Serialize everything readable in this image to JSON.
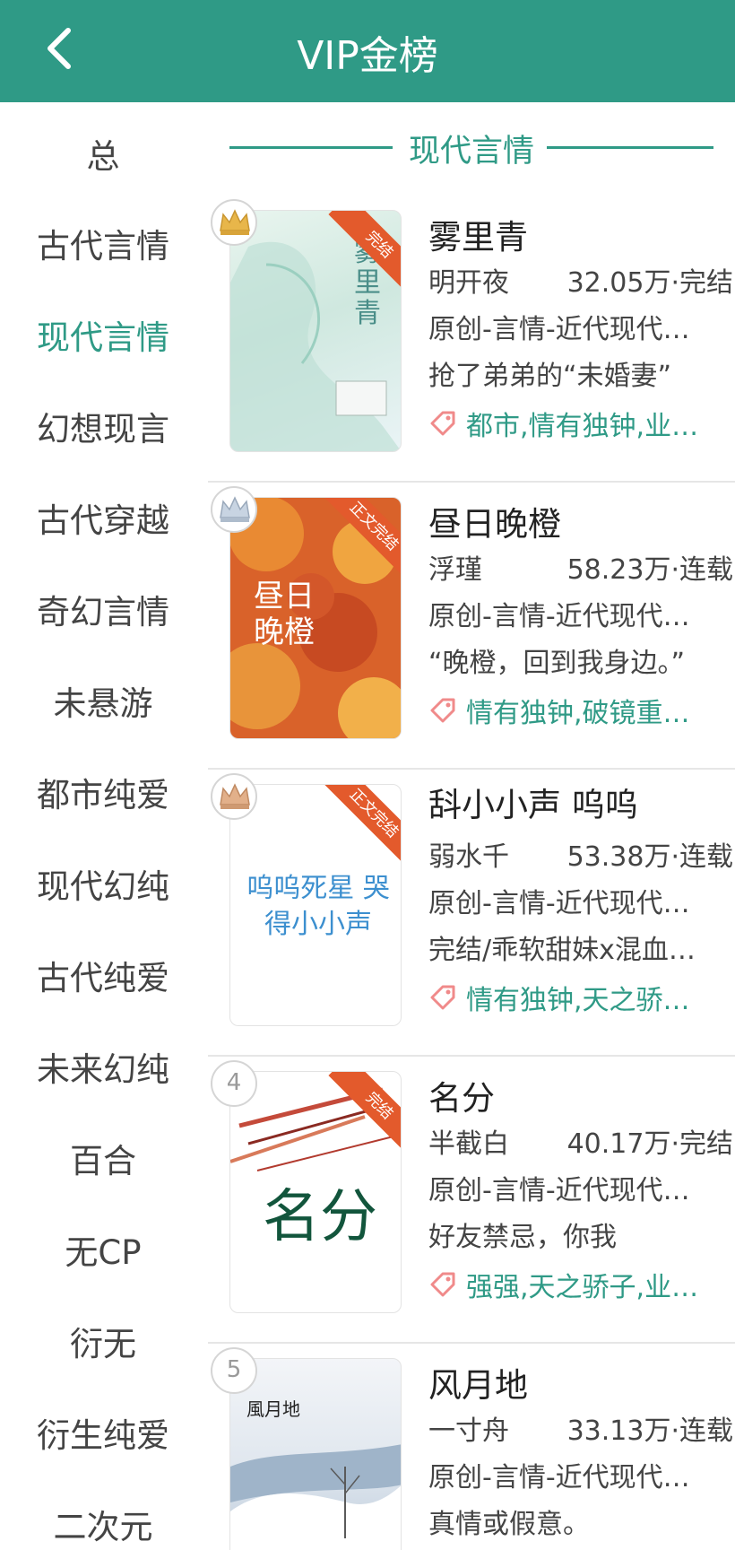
{
  "header": {
    "title": "VIP金榜"
  },
  "sidebar": {
    "items": [
      "总",
      "古代言情",
      "现代言情",
      "幻想现言",
      "古代穿越",
      "奇幻言情",
      "未悬游",
      "都市纯爱",
      "现代幻纯",
      "古代纯爱",
      "未来幻纯",
      "百合",
      "无CP",
      "衍无",
      "衍生纯爱",
      "二次元"
    ],
    "active": "现代言情"
  },
  "section": {
    "title": "现代言情"
  },
  "books": [
    {
      "rank": "1",
      "rank_icon": "crown-gold-icon",
      "ribbon": "完结",
      "cover_title": "雾里青",
      "name": "雾里青",
      "author": "明开夜",
      "stat": "32.05万·完结",
      "category": "原创-言情-近代现代…",
      "blurb": "抢了弟弟的“未婚妻”",
      "tags": "都市,情有独钟,业…"
    },
    {
      "rank": "2",
      "rank_icon": "crown-silver-icon",
      "ribbon": "正文完结",
      "cover_title": "昼日晚橙",
      "name": "昼日晚橙",
      "author": "浮瑾",
      "stat": "58.23万·连载",
      "category": "原创-言情-近代现代…",
      "blurb": "“晚橙，回到我身边。”",
      "tags": "情有独钟,破镜重…"
    },
    {
      "rank": "3",
      "rank_icon": "crown-bronze-icon",
      "ribbon": "正文完结",
      "cover_title": "呜呜死星 哭得小小声",
      "name": "𣁳小小声          呜呜",
      "author": "弱水千",
      "stat": "53.38万·连载",
      "category": "原创-言情-近代现代…",
      "blurb": "完结/乖软甜妹x混血…",
      "tags": "情有独钟,天之骄…"
    },
    {
      "rank": "4",
      "rank_icon": "",
      "ribbon": "完结",
      "cover_title": "名分",
      "name": "名分",
      "author": "半截白",
      "stat": "40.17万·完结",
      "category": "原创-言情-近代现代…",
      "blurb": "好友禁忌，你我",
      "tags": "强强,天之骄子,业…"
    },
    {
      "rank": "5",
      "rank_icon": "",
      "ribbon": "",
      "cover_title": "風月地",
      "name": "风月地",
      "author": "一寸舟",
      "stat": "33.13万·连载",
      "category": "原创-言情-近代现代…",
      "blurb": "真情或假意。",
      "tags": ""
    }
  ],
  "colors": {
    "accent": "#2f9a86",
    "ribbon": "#e35a2c"
  }
}
